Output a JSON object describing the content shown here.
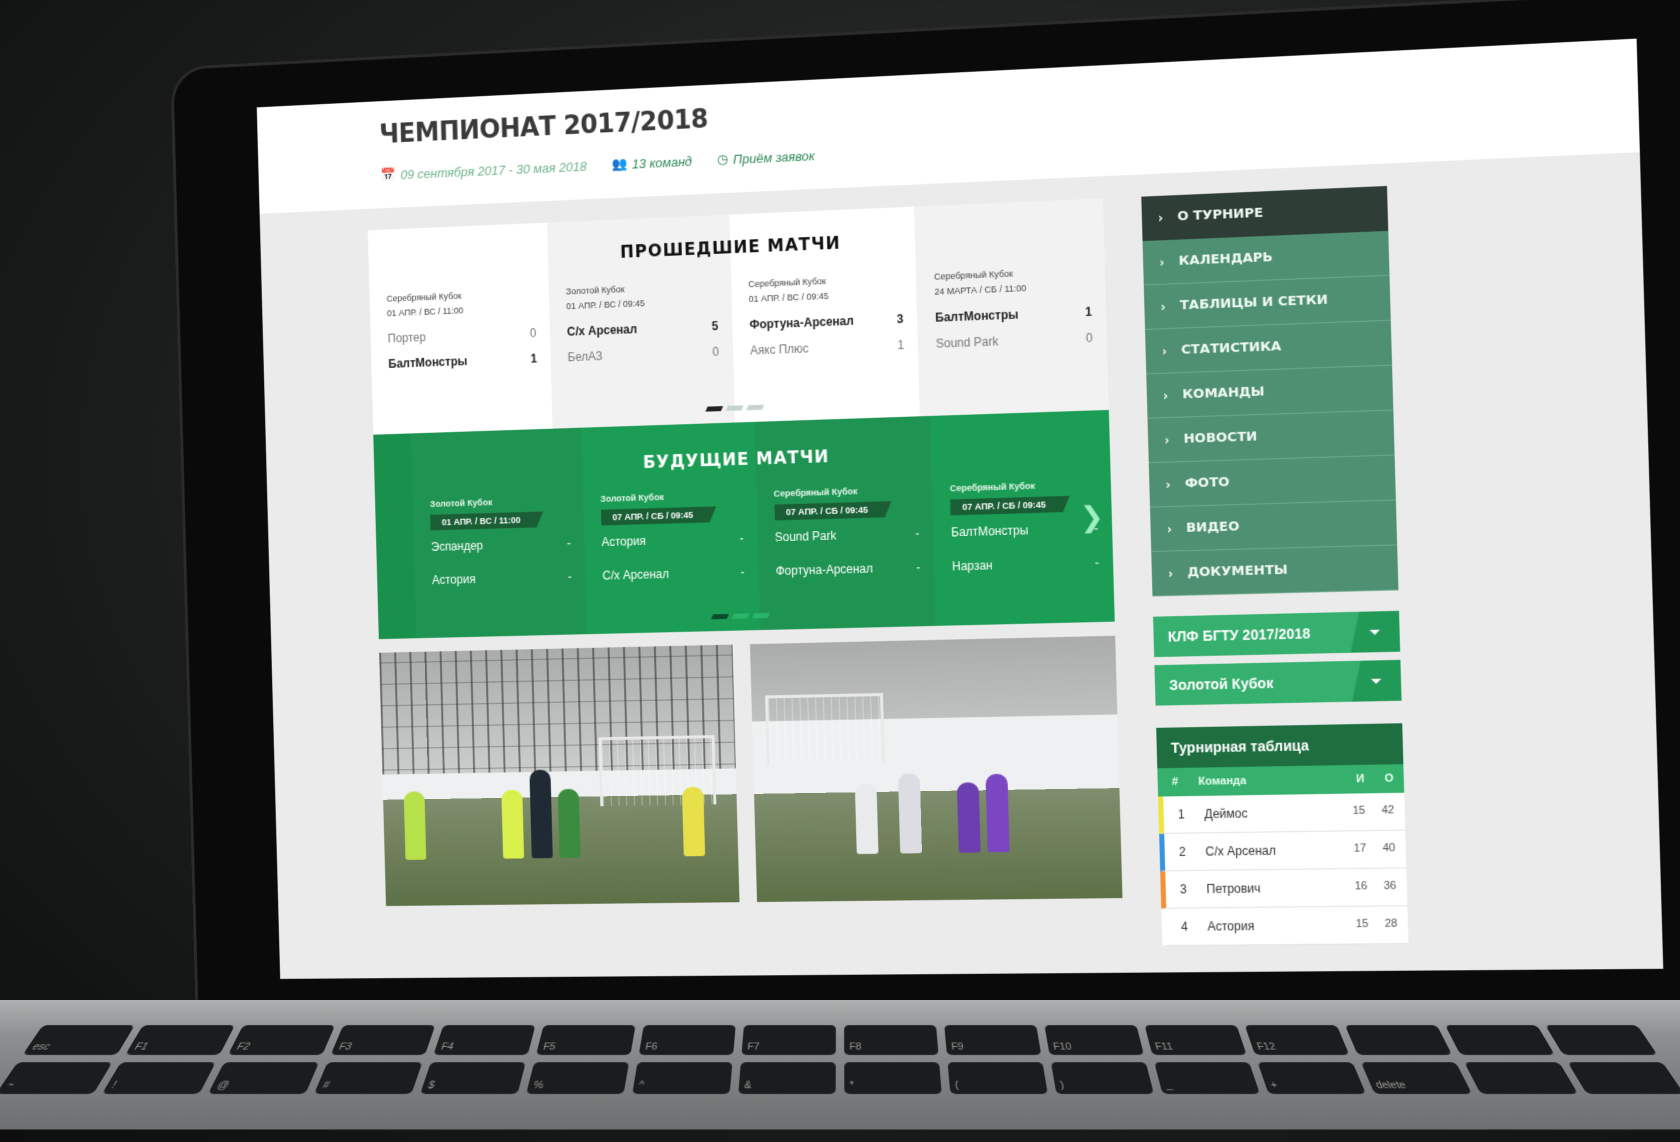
{
  "header": {
    "title": "ЧЕМПИОНАТ 2017/2018",
    "dates": "09 сентября 2017 - 30 мая 2018",
    "teams": "13 команд",
    "status": "Приём заявок",
    "icons": {
      "dates": "calendar-icon",
      "teams": "users-icon",
      "status": "clock-icon"
    }
  },
  "past_matches": {
    "title": "ПРОШЕДШИЕ МАТЧИ",
    "pagination": {
      "pages": 3,
      "active": 1
    },
    "matches": [
      {
        "cup": "Серебряный Кубок",
        "when": "01 АПР. / ВС / 11:00",
        "home": {
          "name": "Портер",
          "score": "0",
          "winner": false
        },
        "away": {
          "name": "БалтМонстры",
          "score": "1",
          "winner": true
        }
      },
      {
        "cup": "Золотой Кубок",
        "when": "01 АПР. / ВС / 09:45",
        "home": {
          "name": "С/х Арсенал",
          "score": "5",
          "winner": true
        },
        "away": {
          "name": "БелАЗ",
          "score": "0",
          "winner": false
        }
      },
      {
        "cup": "Серебряный Кубок",
        "when": "01 АПР. / ВС / 09:45",
        "home": {
          "name": "Фортуна-Арсенал",
          "score": "3",
          "winner": true
        },
        "away": {
          "name": "Аякс Плюс",
          "score": "1",
          "winner": false
        }
      },
      {
        "cup": "Серебряный Кубок",
        "when": "24 МАРТА / СБ / 11:00",
        "home": {
          "name": "БалтМонстры",
          "score": "1",
          "winner": true
        },
        "away": {
          "name": "Sound Park",
          "score": "0",
          "winner": false
        }
      }
    ]
  },
  "future_matches": {
    "title": "БУДУЩИЕ МАТЧИ",
    "pagination": {
      "pages": 3,
      "active": 1
    },
    "next_icon": "chevron-right-icon",
    "matches": [
      {
        "cup": "Золотой Кубок",
        "when": "01 АПР. / ВС / 11:00",
        "home": {
          "name": "Эспандер",
          "score": "-"
        },
        "away": {
          "name": "Астория",
          "score": "-"
        }
      },
      {
        "cup": "Золотой Кубок",
        "when": "07 АПР. / СБ / 09:45",
        "home": {
          "name": "Астория",
          "score": "-"
        },
        "away": {
          "name": "С/х Арсенал",
          "score": "-"
        }
      },
      {
        "cup": "Серебряный Кубок",
        "when": "07 АПР. / СБ / 09:45",
        "home": {
          "name": "Sound Park",
          "score": "-"
        },
        "away": {
          "name": "Фортуна-Арсенал",
          "score": "-"
        }
      },
      {
        "cup": "Серебряный Кубок",
        "when": "07 АПР. / СБ / 09:45",
        "home": {
          "name": "БалтМонстры",
          "score": "-"
        },
        "away": {
          "name": "Нарзан",
          "score": "-"
        }
      }
    ]
  },
  "photos": [
    {
      "name": "match-photo-1"
    },
    {
      "name": "match-photo-2"
    }
  ],
  "sidebar": {
    "nav": [
      {
        "label": "О ТУРНИРЕ",
        "active": true
      },
      {
        "label": "КАЛЕНДАРЬ",
        "active": false
      },
      {
        "label": "ТАБЛИЦЫ И СЕТКИ",
        "active": false
      },
      {
        "label": "СТАТИСТИКА",
        "active": false
      },
      {
        "label": "КОМАНДЫ",
        "active": false
      },
      {
        "label": "НОВОСТИ",
        "active": false
      },
      {
        "label": "ФОТО",
        "active": false
      },
      {
        "label": "ВИДЕО",
        "active": false
      },
      {
        "label": "ДОКУМЕНТЫ",
        "active": false
      }
    ],
    "season_select": "КЛФ БГТУ 2017/2018",
    "cup_select": "Золотой Кубок"
  },
  "standings": {
    "title": "Турнирная таблица",
    "columns": [
      "#",
      "Команда",
      "И",
      "О"
    ],
    "rows": [
      {
        "pos": "1",
        "team": "Деймос",
        "played": "15",
        "points": "42",
        "marker": "#f2e33a"
      },
      {
        "pos": "2",
        "team": "С/х Арсенал",
        "played": "17",
        "points": "40",
        "marker": "#3a93e0"
      },
      {
        "pos": "3",
        "team": "Петрович",
        "played": "16",
        "points": "36",
        "marker": "#f3913a"
      },
      {
        "pos": "4",
        "team": "Астория",
        "played": "15",
        "points": "28",
        "marker": ""
      }
    ]
  },
  "keyboard": {
    "keys": [
      "esc",
      "F1",
      "F2",
      "F3",
      "F4",
      "F5",
      "F6",
      "F7",
      "F8",
      "F9",
      "F10",
      "F11",
      "F12",
      "",
      "",
      "",
      "~",
      "!",
      "@",
      "#",
      "$",
      "%",
      "^",
      "&",
      "*",
      "(",
      ")",
      "_",
      "+",
      "delete",
      "",
      ""
    ]
  },
  "colors": {
    "brand_green": "#1c9d55",
    "nav_green": "#4f8f72",
    "nav_active": "#2e3d36",
    "accent_green": "#35b06d",
    "dark_green": "#1e6e40"
  }
}
